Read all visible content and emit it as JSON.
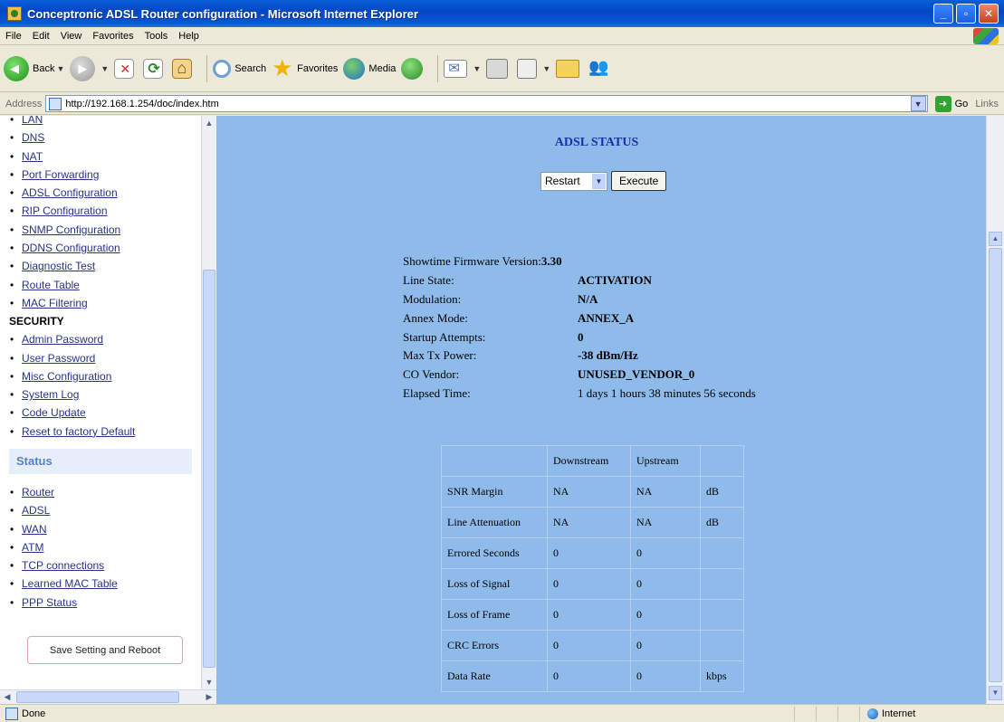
{
  "window": {
    "title": "Conceptronic ADSL Router configuration - Microsoft Internet Explorer"
  },
  "menubar": [
    "File",
    "Edit",
    "View",
    "Favorites",
    "Tools",
    "Help"
  ],
  "toolbar": {
    "back": "Back",
    "search": "Search",
    "favorites": "Favorites",
    "media": "Media"
  },
  "addressbar": {
    "label": "Address",
    "url": "http://192.168.1.254/doc/index.htm",
    "go": "Go",
    "links": "Links"
  },
  "sidebar": {
    "config_items": [
      "LAN",
      "DNS",
      "NAT",
      "Port Forwarding",
      "ADSL Configuration",
      "RIP Configuration",
      "SNMP Configuration",
      "DDNS Configuration",
      "Diagnostic Test",
      "Route Table",
      "MAC Filtering"
    ],
    "security_heading": "SECURITY",
    "security_items": [
      "Admin Password",
      "User Password",
      "Misc Configuration",
      "System Log",
      "Code Update",
      "Reset to factory Default"
    ],
    "status_heading": "Status",
    "status_items": [
      "Router",
      "ADSL",
      "WAN",
      "ATM",
      "TCP connections",
      "Learned MAC Table",
      "PPP Status"
    ],
    "save_button": "Save Setting and Reboot"
  },
  "main": {
    "title": "ADSL STATUS",
    "select_value": "Restart",
    "execute": "Execute",
    "info": [
      {
        "label": "Showtime Firmware Version:",
        "value": "3.30"
      },
      {
        "label": "Line State:",
        "value": "ACTIVATION"
      },
      {
        "label": "Modulation:",
        "value": "N/A"
      },
      {
        "label": "Annex Mode:",
        "value": "ANNEX_A"
      },
      {
        "label": "Startup Attempts:",
        "value": "0"
      },
      {
        "label": "Max Tx Power:",
        "value": "-38 dBm/Hz"
      },
      {
        "label": "CO Vendor:",
        "value": "UNUSED_VENDOR_0"
      },
      {
        "label": "Elapsed Time:",
        "value": "1 days 1 hours 38 minutes 56 seconds"
      }
    ],
    "table": {
      "headers": [
        "",
        "Downstream",
        "Upstream",
        ""
      ],
      "rows": [
        [
          "SNR Margin",
          "NA",
          "NA",
          "dB"
        ],
        [
          "Line Attenuation",
          "NA",
          "NA",
          "dB"
        ],
        [
          "Errored Seconds",
          "0",
          "0",
          ""
        ],
        [
          "Loss of Signal",
          "0",
          "0",
          ""
        ],
        [
          "Loss of Frame",
          "0",
          "0",
          ""
        ],
        [
          "CRC Errors",
          "0",
          "0",
          ""
        ],
        [
          "Data Rate",
          "0",
          "0",
          "kbps"
        ]
      ]
    }
  },
  "statusbar": {
    "text": "Done",
    "zone": "Internet"
  }
}
